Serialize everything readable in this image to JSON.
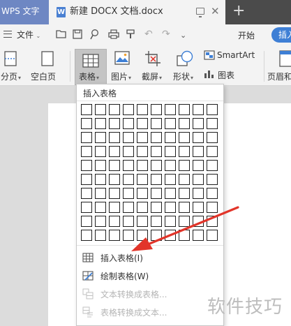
{
  "tabs": {
    "app_tab": "WPS 文字",
    "doc_icon_letter": "W",
    "doc_tab": "新建 DOCX 文档.docx",
    "close": "✕",
    "new_tab": "+"
  },
  "menubar": {
    "file": "文件",
    "start": "开始",
    "insert": "插入"
  },
  "ribbon": {
    "page_break": "分页",
    "blank_page": "空白页",
    "table": "表格",
    "picture": "图片",
    "screenshot": "截屏",
    "shape": "形状",
    "smartart": "SmartArt",
    "chart": "图表",
    "header_footer": "页眉和"
  },
  "dropdown": {
    "header": "插入表格",
    "grid": {
      "rows": 10,
      "cols": 10
    },
    "items": [
      {
        "label": "插入表格(I)",
        "enabled": true
      },
      {
        "label": "绘制表格(W)",
        "enabled": true
      },
      {
        "label": "文本转换成表格...",
        "enabled": false
      },
      {
        "label": "表格转换成文本...",
        "enabled": false
      }
    ]
  },
  "colors": {
    "accent": "#3e7fd5",
    "arrow": "#e2352a",
    "titlebar": "#4b4b4b"
  },
  "watermark": "软件技巧"
}
